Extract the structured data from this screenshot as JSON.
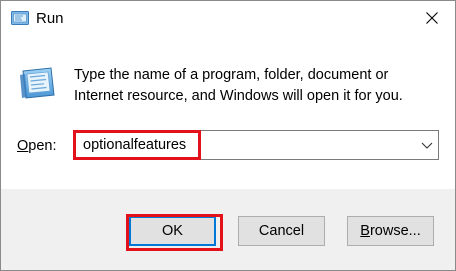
{
  "window": {
    "title": "Run",
    "app_icon": "run-app-icon",
    "close_icon": "close-icon"
  },
  "body": {
    "icon": "run-dialog-icon",
    "description": "Type the name of a program, folder, document or Internet resource, and Windows will open it for you."
  },
  "open_field": {
    "label_accel": "O",
    "label_rest": "pen:",
    "value": "optionalfeatures",
    "dropdown_icon": "chevron-down-icon"
  },
  "buttons": {
    "ok": "OK",
    "cancel": "Cancel",
    "browse_accel": "B",
    "browse_rest": "rowse..."
  },
  "colors": {
    "highlight": "#e3121a",
    "focus": "#0078d7",
    "footer_bg": "#f0f0f0"
  }
}
